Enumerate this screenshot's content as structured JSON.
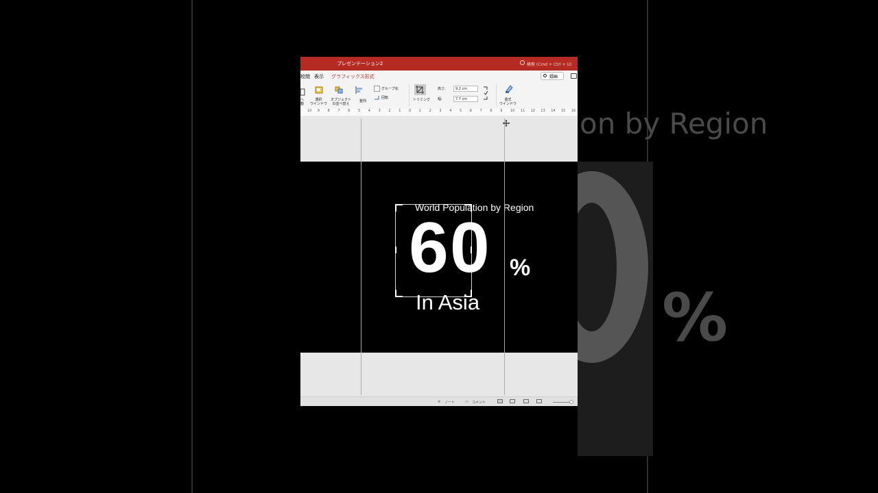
{
  "window": {
    "document_title": "プレゼンテーション2",
    "search_placeholder": "検索 (Cmd + Ctrl + U)"
  },
  "tabs": [
    {
      "label": "校閲"
    },
    {
      "label": "表示"
    },
    {
      "label": "グラフィックス形式",
      "active": true
    }
  ],
  "record_button": "録画",
  "ribbon": {
    "bring_forward": "へ\n動",
    "selection_pane": "選択\nウインドウ",
    "reorder_objects": "オブジェクト\nの並べ替え",
    "align": "整列",
    "group": "グループ化",
    "rotate": "回転",
    "crop": "トリミング",
    "height_label": "高さ:",
    "height_value": "9.2 cm",
    "width_label": "幅:",
    "width_value": "7.7 cm",
    "format_pane": "書式\nウインドウ"
  },
  "ruler_ticks": [
    "10",
    "9",
    "8",
    "7",
    "6",
    "5",
    "4",
    "3",
    "2",
    "1",
    "0",
    "1",
    "2",
    "3",
    "4",
    "5",
    "6",
    "7",
    "8",
    "9",
    "10",
    "11",
    "12",
    "13",
    "14",
    "15",
    "16"
  ],
  "slide": {
    "title": "World Population by Region",
    "number": "60",
    "percent": "%",
    "subtitle": "In Asia"
  },
  "background_copy": {
    "title_fragment": "on by Region",
    "percent": "%"
  },
  "statusbar": {
    "notes": "ノート",
    "comments": "コメント"
  },
  "colors": {
    "accent": "#b52a22",
    "slide_bg": "#000000",
    "text": "#ffffff"
  }
}
